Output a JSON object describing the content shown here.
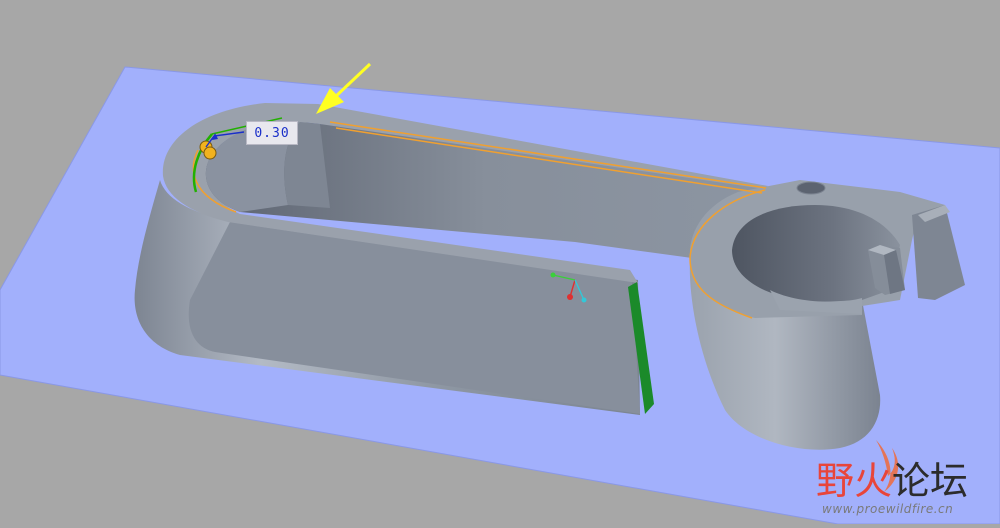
{
  "viewport": {
    "background_color": "#a7a7a7",
    "plane_color": "#a2b0fc",
    "part_color": "#8c95a2",
    "highlight_edge_color": "#f0a030",
    "selected_surface_color": "#1b8a2a",
    "arrow_color": "#ffff22"
  },
  "dimension": {
    "value": "0.30"
  },
  "watermark": {
    "title_part1": "野火",
    "title_part2": "论坛",
    "url": "www.proewildfire.cn"
  },
  "icons": {
    "datum_triad": "coordinate-triad-icon",
    "drag_handle": "drag-handle-icon",
    "pointer_arrow": "arrow-icon",
    "flame": "flame-icon"
  }
}
